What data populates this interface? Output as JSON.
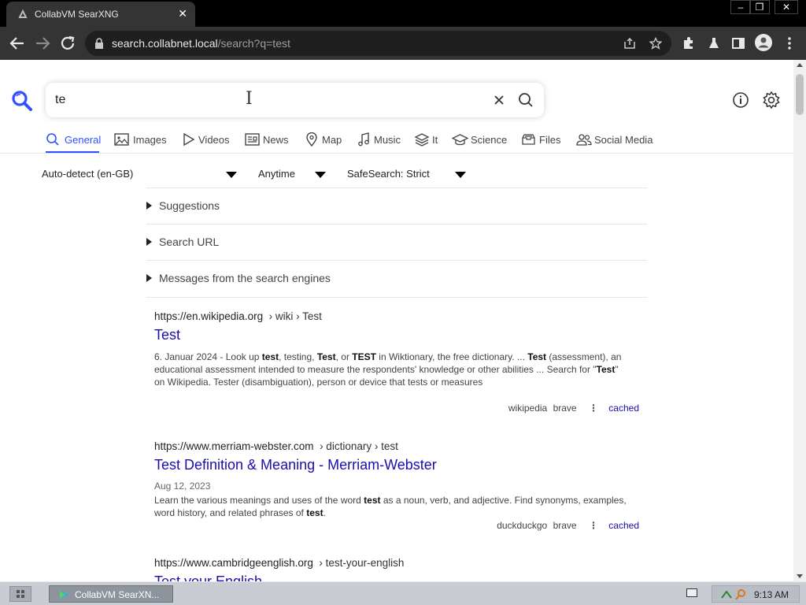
{
  "browser": {
    "tab_title": "CollabVM SearXNG",
    "url_host": "search.collabnet.local",
    "url_path": "/search?q=test"
  },
  "search": {
    "query_value": "te"
  },
  "categories": [
    {
      "label": "General",
      "icon": "search-icon"
    },
    {
      "label": "Images",
      "icon": "image-icon"
    },
    {
      "label": "Videos",
      "icon": "play-icon"
    },
    {
      "label": "News",
      "icon": "newspaper-icon"
    },
    {
      "label": "Map",
      "icon": "map-pin-icon"
    },
    {
      "label": "Music",
      "icon": "music-note-icon"
    },
    {
      "label": "It",
      "icon": "layers-icon"
    },
    {
      "label": "Science",
      "icon": "graduation-cap-icon"
    },
    {
      "label": "Files",
      "icon": "file-tray-icon"
    },
    {
      "label": "Social Media",
      "icon": "people-icon"
    }
  ],
  "filters": {
    "language": "Auto-detect (en-GB)",
    "time": "Anytime",
    "safesearch": "SafeSearch: Strict"
  },
  "details": [
    "Suggestions",
    "Search URL",
    "Messages from the search engines"
  ],
  "results": [
    {
      "url": "https://en.wikipedia.org",
      "crumb": "› wiki › Test",
      "title": "Test",
      "date": "",
      "snippet_html": "6. Januar 2024 - Look up <b>test</b>, testing, <b>Test</b>, or <b>TEST</b> in Wiktionary, the free dictionary. ... <b>Test</b> (assessment), an educational assessment intended to measure the respondents' knowledge or other abilities ... Search for \"<b>Test</b>\" on Wikipedia. Tester (disambiguation), person or device that tests or measures",
      "engines": [
        "wikipedia",
        "brave"
      ],
      "cached": "cached"
    },
    {
      "url": "https://www.merriam-webster.com",
      "crumb": "› dictionary › test",
      "title": "Test Definition & Meaning - Merriam-Webster",
      "date": "Aug 12, 2023",
      "snippet_html": "Learn the various meanings and uses of the word <b>test</b> as a noun, verb, and adjective. Find synonyms, examples, word history, and related phrases of <b>test</b>.",
      "engines": [
        "duckduckgo",
        "brave"
      ],
      "cached": "cached"
    },
    {
      "url": "https://www.cambridgeenglish.org",
      "crumb": "› test-your-english",
      "title": "Test your English"
    }
  ],
  "taskbar": {
    "task_label": "CollabVM SearXN...",
    "clock": "9:13 AM"
  },
  "colors": {
    "accent": "#3050ff",
    "link": "#1a0dab"
  }
}
